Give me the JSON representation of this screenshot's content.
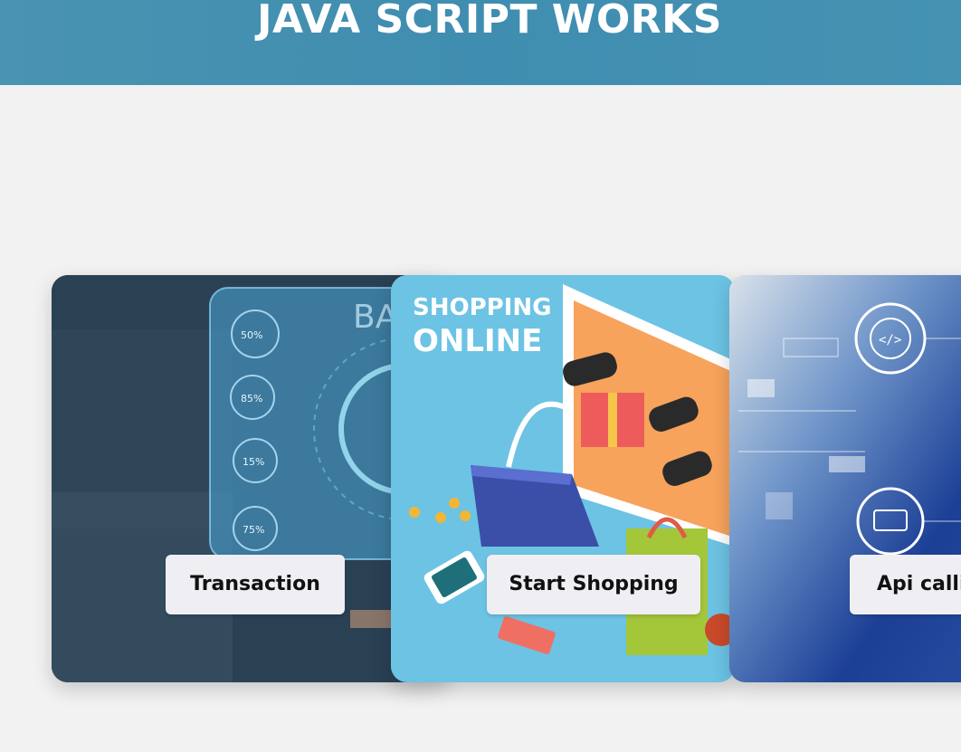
{
  "header": {
    "title": "JAVA SCRIPT WORKS",
    "background_color": "#4592b3"
  },
  "cards": [
    {
      "id": "transaction",
      "button_label": "Transaction",
      "image_text": "BA",
      "gauge_labels": [
        "50%",
        "85%",
        "15%",
        "75%"
      ],
      "image_desc_icon": "banking-dashboard-image"
    },
    {
      "id": "shopping",
      "button_label": "Start Shopping",
      "image_heading_1": "SHOPPING",
      "image_heading_2": "ONLINE",
      "image_desc_icon": "online-shopping-image"
    },
    {
      "id": "api",
      "button_label": "Api calli",
      "image_desc_icon": "technology-circuit-image"
    }
  ]
}
